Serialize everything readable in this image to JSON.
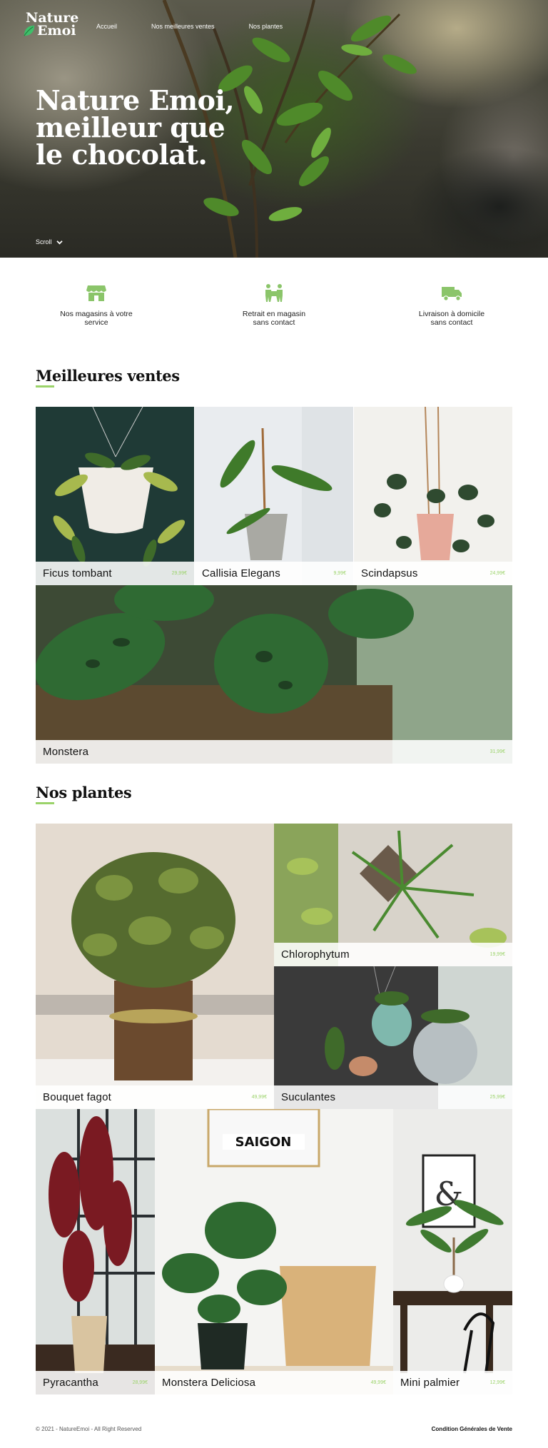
{
  "brand": {
    "logo_line1": "Nature",
    "logo_line2": "Emoi"
  },
  "nav": {
    "items": [
      "Accueil",
      "Nos meilleures ventes",
      "Nos plantes"
    ]
  },
  "hero": {
    "title_lines": [
      "Nature Emoi,",
      "meilleur que",
      "le chocolat."
    ],
    "scroll_label": "Scroll"
  },
  "services": [
    {
      "icon": "shop-icon",
      "line1": "Nos magasins à votre",
      "line2": "service"
    },
    {
      "icon": "pickup-icon",
      "line1": "Retrait en magasin",
      "line2": "sans contact"
    },
    {
      "icon": "truck-icon",
      "line1": "Livraison à domicile",
      "line2": "sans contact"
    }
  ],
  "bestsellers": {
    "title": "Meilleures ventes",
    "items": [
      {
        "name": "Ficus tombant",
        "price": "29,99€"
      },
      {
        "name": "Callisia Elegans",
        "price": "9,99€"
      },
      {
        "name": "Scindapsus",
        "price": "24,99€"
      },
      {
        "name": "Monstera",
        "price": "31,99€"
      }
    ]
  },
  "plants": {
    "title": "Nos plantes",
    "items": [
      {
        "name": "Bouquet fagot",
        "price": "49,99€"
      },
      {
        "name": "Chlorophytum",
        "price": "19,99€"
      },
      {
        "name": "Suculantes",
        "price": "25,99€"
      },
      {
        "name": "Pyracantha",
        "price": "28,99€"
      },
      {
        "name": "Monstera Deliciosa",
        "price": "49,99€"
      },
      {
        "name": "Mini palmier",
        "price": "12,99€"
      }
    ],
    "poster_text": "SAIGON"
  },
  "footer": {
    "copyright": "© 2021 - NatureEmoi - All Right Reserved",
    "cgv": "Condition Générales de Vente"
  },
  "colors": {
    "accent": "#9bd36a",
    "icon_green": "#8bc56a"
  }
}
